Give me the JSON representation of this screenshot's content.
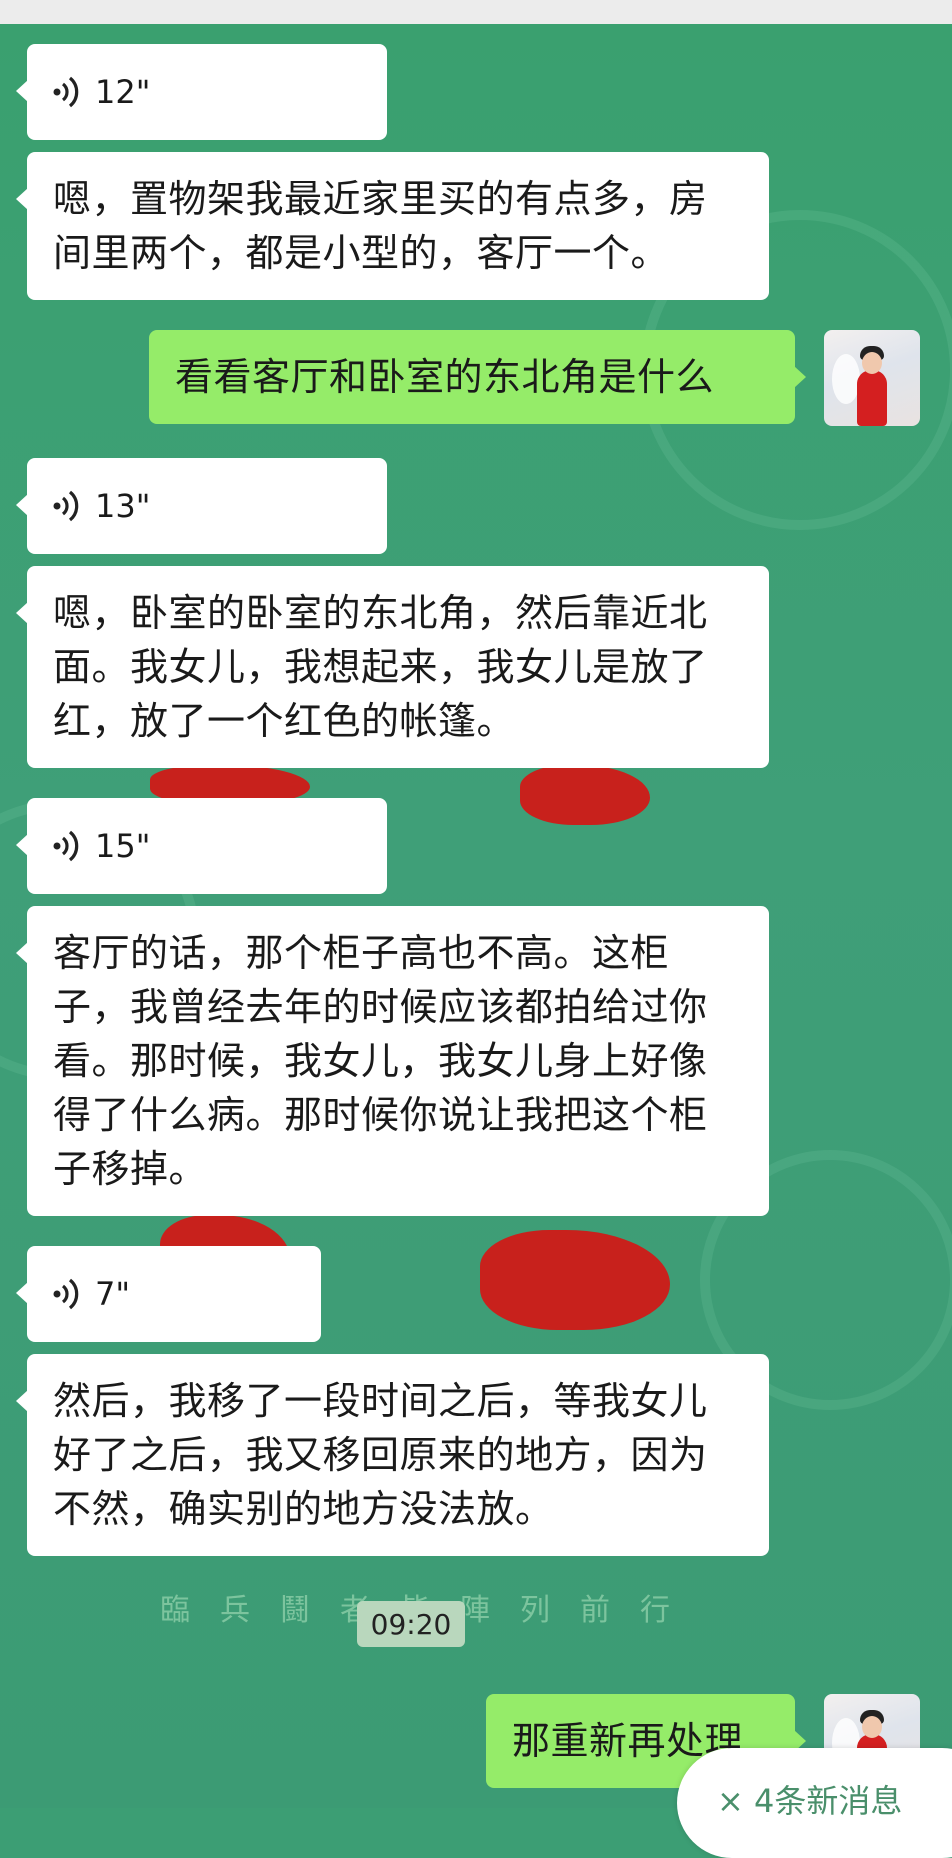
{
  "messages": [
    {
      "type": "voice",
      "side": "left",
      "duration": "12\""
    },
    {
      "type": "text",
      "side": "left",
      "text": "嗯，置物架我最近家里买的有点多，房间里两个，都是小型的，客厅一个。"
    },
    {
      "type": "text",
      "side": "right",
      "text": "看看客厅和卧室的东北角是什么"
    },
    {
      "type": "voice",
      "side": "left",
      "duration": "13\""
    },
    {
      "type": "text",
      "side": "left",
      "text": "嗯，卧室的卧室的东北角，然后靠近北面。我女儿，我想起来，我女儿是放了红，放了一个红色的帐篷。"
    },
    {
      "type": "voice",
      "side": "left",
      "duration": "15\""
    },
    {
      "type": "text",
      "side": "left",
      "text": "客厅的话，那个柜子高也不高。这柜子，我曾经去年的时候应该都拍给过你看。那时候，我女儿，我女儿身上好像得了什么病。那时候你说让我把这个柜子移掉。"
    },
    {
      "type": "voice",
      "side": "left",
      "duration": "7\""
    },
    {
      "type": "text",
      "side": "left",
      "text": "然后，我移了一段时间之后，等我女儿好了之后，我又移回原来的地方，因为不然，确实别的地方没法放。"
    },
    {
      "type": "text",
      "side": "right",
      "text": "那重新再处理"
    }
  ],
  "timestamp": "09:20",
  "background_watermark": "臨兵鬪者皆陣列前行",
  "new_message_notice": "× 4条新消息",
  "colors": {
    "background": "#3c9e74",
    "self_bubble": "#95ec69",
    "other_bubble": "#ffffff"
  }
}
